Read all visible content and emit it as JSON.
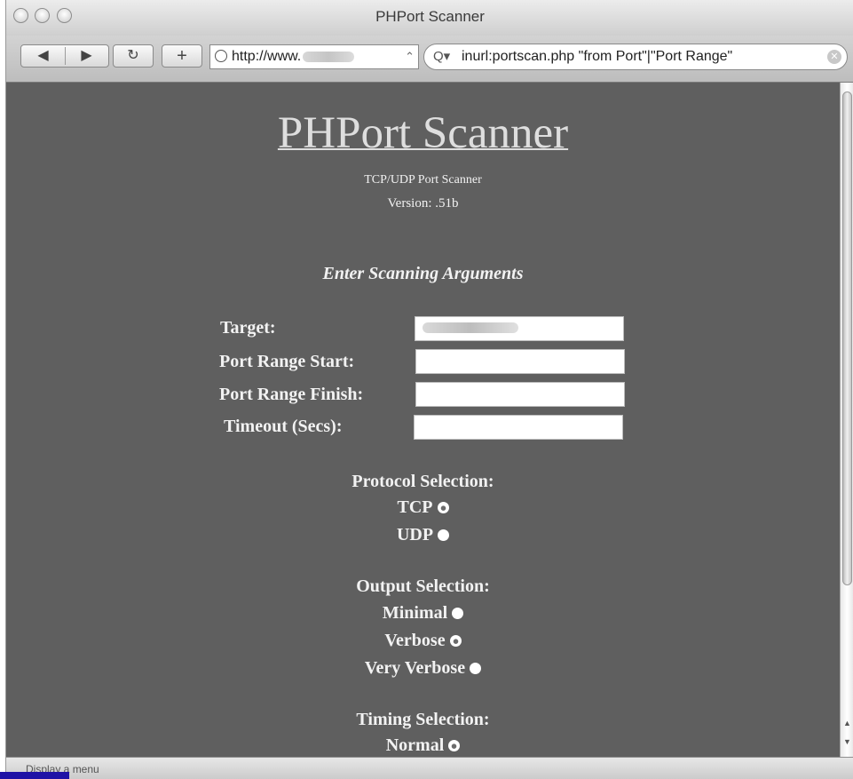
{
  "browser": {
    "window_title": "PHPort Scanner",
    "url_prefix": "http://www.",
    "search_query": "inurl:portscan.php \"from Port\"|\"Port Range\"",
    "status_text": "Display a menu"
  },
  "page": {
    "title": "PHPort Scanner",
    "subtitle": "TCP/UDP Port Scanner",
    "version": "Version: .51b",
    "args_heading": "Enter Scanning Arguments",
    "fields": [
      {
        "label": "Target:",
        "value": ""
      },
      {
        "label": "Port Range Start:",
        "value": ""
      },
      {
        "label": "Port Range Finish:",
        "value": ""
      },
      {
        "label": "Timeout (Secs):",
        "value": ""
      }
    ],
    "protocol": {
      "heading": "Protocol Selection:",
      "options": [
        {
          "label": "TCP",
          "selected": true
        },
        {
          "label": "UDP",
          "selected": false
        }
      ]
    },
    "output": {
      "heading": "Output Selection:",
      "options": [
        {
          "label": "Minimal",
          "selected": false
        },
        {
          "label": "Verbose",
          "selected": true
        },
        {
          "label": "Very Verbose",
          "selected": false
        }
      ]
    },
    "timing": {
      "heading": "Timing Selection:",
      "options": [
        {
          "label": "Normal",
          "selected": true
        }
      ]
    }
  },
  "icons": {
    "back": "back-arrow-icon",
    "forward": "forward-arrow-icon",
    "reload": "reload-icon",
    "add_bookmark": "plus-icon",
    "globe": "globe-icon",
    "search": "magnifier-icon",
    "clear": "clear-icon",
    "radio": "radio-button-icon"
  }
}
